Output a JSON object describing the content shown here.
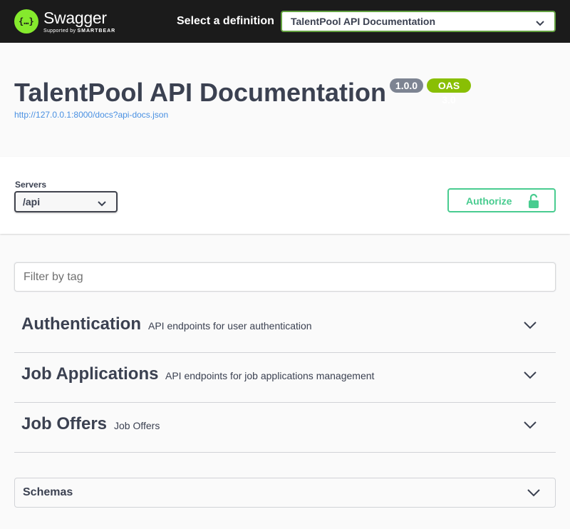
{
  "topbar": {
    "brand": "Swagger",
    "brand_sub_prefix": "Supported by",
    "brand_sub_name": "SMARTBEAR",
    "definition_label": "Select a definition",
    "definition_value": "TalentPool API Documentation",
    "background": "#1b1b1b",
    "brand_color": "#85ea2d"
  },
  "info": {
    "title": "TalentPool API Documentation",
    "version_badge": "1.0.0",
    "oas_badge": "OAS 3.0",
    "doc_url": "http://127.0.0.1:8000/docs?api-docs.json"
  },
  "servers": {
    "label": "Servers",
    "selected": "/api"
  },
  "authorize": {
    "label": "Authorize",
    "icon": "unlocked-lock-icon",
    "color": "#49cc90"
  },
  "filter": {
    "placeholder": "Filter by tag",
    "value": ""
  },
  "tags": [
    {
      "name": "Authentication",
      "description": "API endpoints for user authentication"
    },
    {
      "name": "Job Applications",
      "description": "API endpoints for job applications management"
    },
    {
      "name": "Job Offers",
      "description": "Job Offers"
    }
  ],
  "schemas": {
    "label": "Schemas"
  }
}
